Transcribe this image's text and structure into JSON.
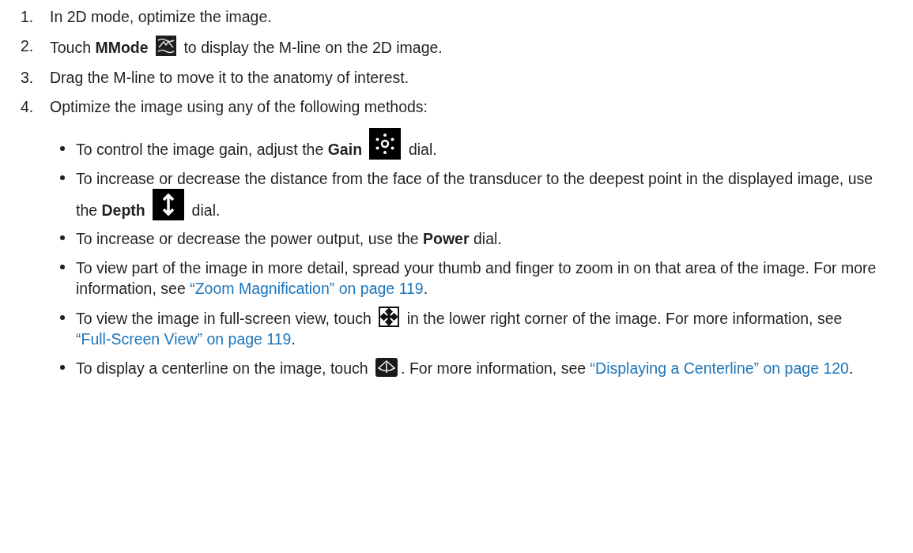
{
  "steps": [
    {
      "number": "1.",
      "parts": [
        {
          "kind": "text",
          "text": "In 2D mode, optimize the image."
        }
      ]
    },
    {
      "number": "2.",
      "parts": [
        {
          "kind": "text",
          "text": "Touch **MMode** "
        },
        {
          "kind": "icon"
        },
        {
          "kind": "text",
          "text": " to display the M-line on the 2D image."
        }
      ]
    },
    {
      "number": "3.",
      "parts": [
        {
          "kind": "text",
          "text": "Drag the M-line to move it to the anatomy of interest."
        }
      ]
    },
    {
      "number": "4.",
      "parts": [
        {
          "kind": "text",
          "text": "Optimize the image using any of the following methods:"
        }
      ],
      "bullets": [
        {
          "parts": [
            {
              "kind": "text",
              "text": "To control the image gain, adjust the **Gain** "
            },
            {
              "kind": "icon"
            },
            {
              "kind": "text",
              "text": " dial."
            }
          ]
        },
        {
          "parts": [
            {
              "kind": "text",
              "text": "To increase or decrease the distance from the face of the transducer to the deepest point in the displayed image, use the **Depth** "
            },
            {
              "kind": "icon"
            },
            {
              "kind": "text",
              "text": " dial."
            }
          ]
        },
        {
          "parts": [
            {
              "kind": "text",
              "text": "To increase or decrease the power output, use the **Power** dial."
            }
          ]
        },
        {
          "parts": [
            {
              "kind": "text",
              "text": "To view part of the image in more detail, spread your thumb and finger to zoom in on that area of the image. For more information, see "
            },
            {
              "kind": "link",
              "text": "“Zoom Magnification” on page 119"
            },
            {
              "kind": "text",
              "text": "."
            }
          ]
        },
        {
          "parts": [
            {
              "kind": "text",
              "text": "To view the image in full-screen view, touch "
            },
            {
              "kind": "icon"
            },
            {
              "kind": "text",
              "text": " in the lower right corner of the image. For more information, see "
            },
            {
              "kind": "link",
              "text": "“Full-Screen View” on page 119"
            },
            {
              "kind": "text",
              "text": "."
            }
          ]
        },
        {
          "parts": [
            {
              "kind": "text",
              "text": "To display a centerline on the image, touch "
            },
            {
              "kind": "icon"
            },
            {
              "kind": "text",
              "text": ". For more information, see "
            },
            {
              "kind": "link",
              "text": "“Displaying a Centerline” on page 120"
            },
            {
              "kind": "text",
              "text": "."
            }
          ]
        }
      ]
    }
  ]
}
